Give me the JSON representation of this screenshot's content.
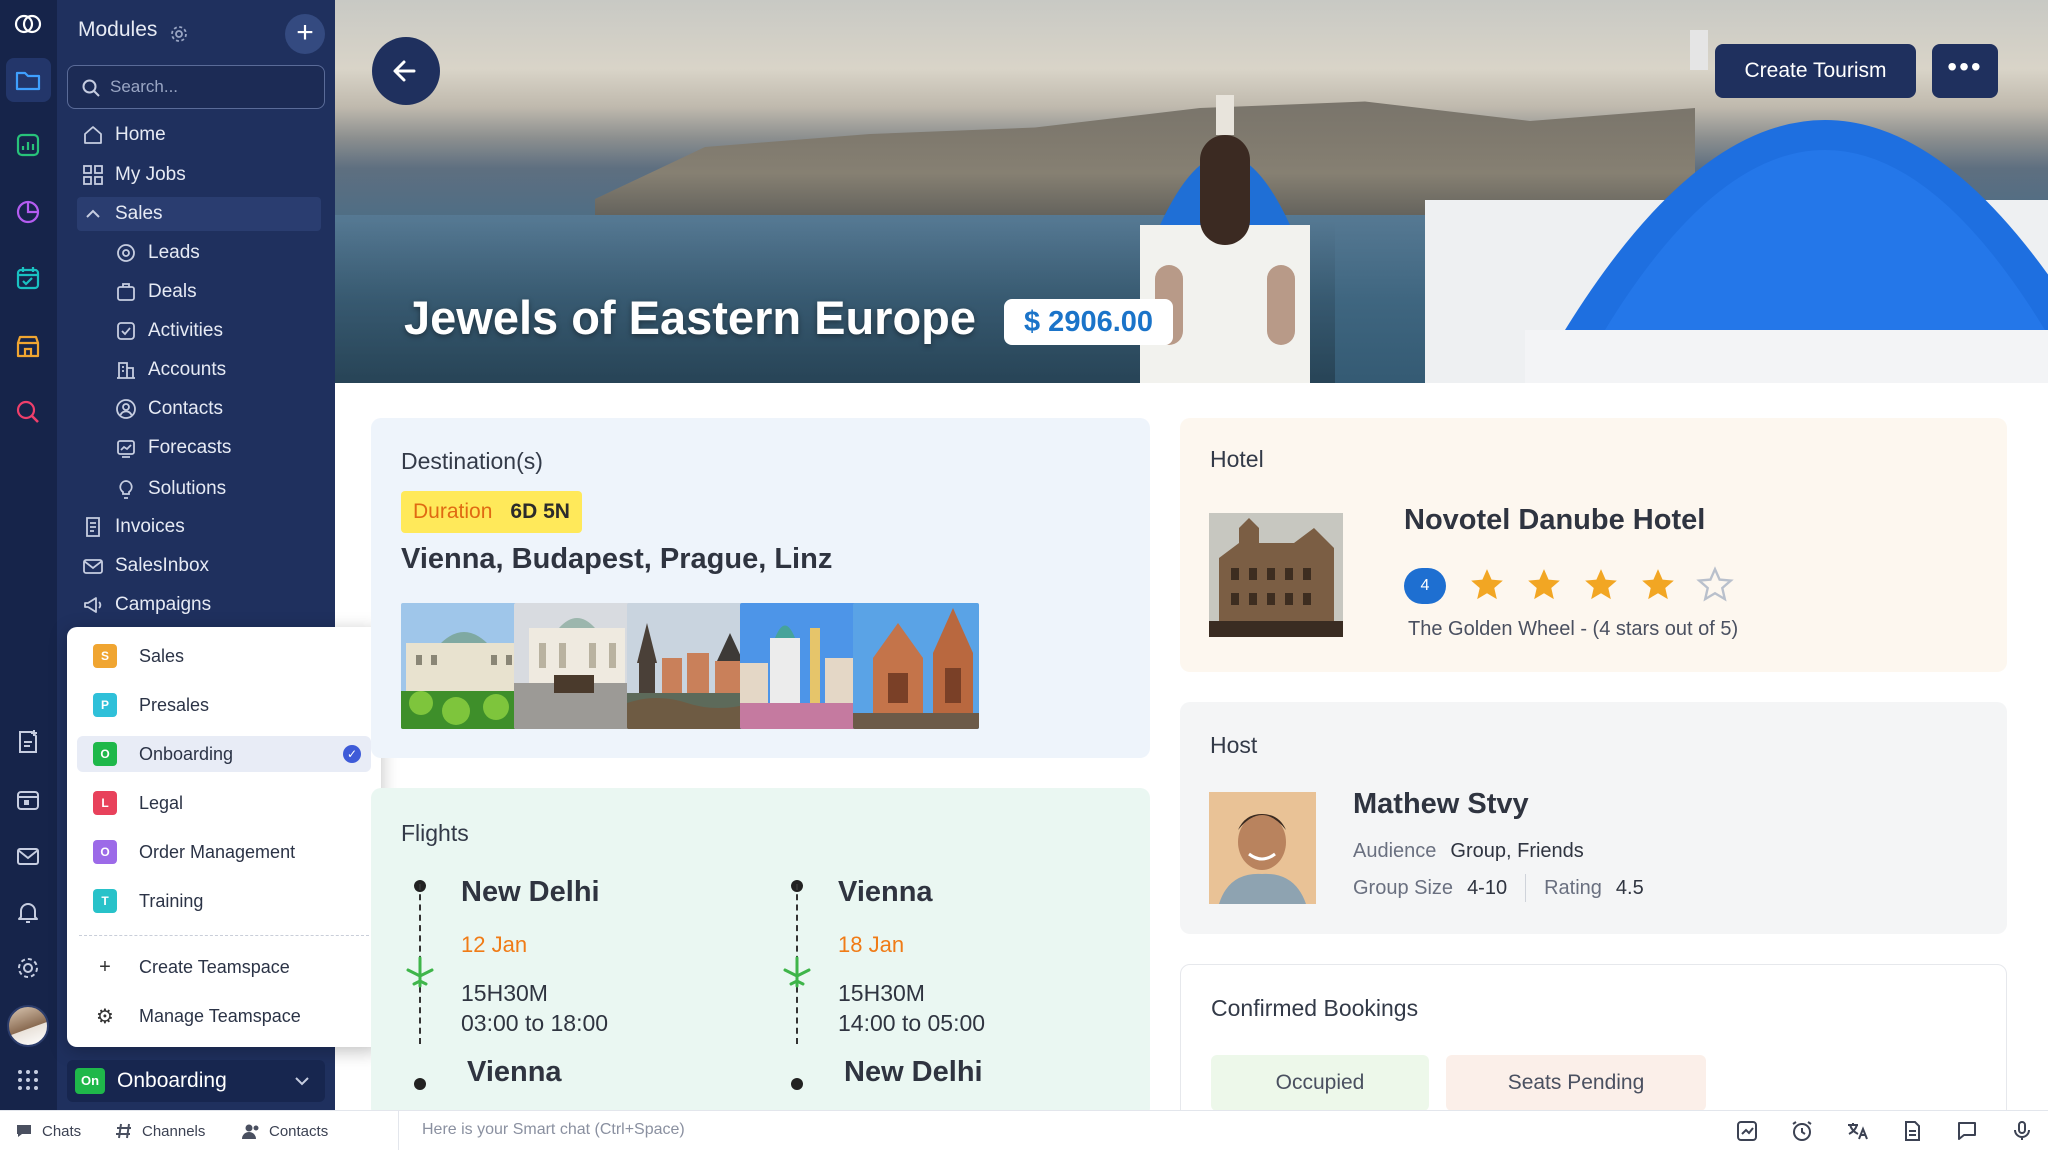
{
  "rail": {
    "icons": [
      "logo-icon",
      "folder-icon",
      "chart-icon",
      "pie-icon",
      "calendar-icon",
      "store-icon",
      "search-analytics-icon",
      "add-note-icon",
      "calendar-small-icon",
      "mail-icon",
      "bell-icon",
      "settings-icon",
      "avatar",
      "apps-grid-icon"
    ]
  },
  "sidebar": {
    "title": "Modules",
    "search_placeholder": "Search...",
    "items": [
      {
        "label": "Home",
        "icon": "home-icon"
      },
      {
        "label": "My Jobs",
        "icon": "grid-icon"
      },
      {
        "label": "Sales",
        "icon": "chevron-up-icon"
      },
      {
        "label": "Leads",
        "icon": "leads-icon"
      },
      {
        "label": "Deals",
        "icon": "deals-icon"
      },
      {
        "label": "Activities",
        "icon": "activities-icon"
      },
      {
        "label": "Accounts",
        "icon": "accounts-icon"
      },
      {
        "label": "Contacts",
        "icon": "contacts-icon"
      },
      {
        "label": "Forecasts",
        "icon": "forecasts-icon"
      },
      {
        "label": "Solutions",
        "icon": "bulb-icon"
      },
      {
        "label": "Invoices",
        "icon": "invoice-icon"
      },
      {
        "label": "SalesInbox",
        "icon": "inbox-icon"
      },
      {
        "label": "Campaigns",
        "icon": "megaphone-icon"
      }
    ]
  },
  "teamspace": {
    "options": [
      {
        "label": "Sales",
        "letter": "S",
        "color": "#f0a531"
      },
      {
        "label": "Presales",
        "letter": "P",
        "color": "#2fc0d9"
      },
      {
        "label": "Onboarding",
        "letter": "O",
        "color": "#1fb84a"
      },
      {
        "label": "Legal",
        "letter": "L",
        "color": "#e8415b"
      },
      {
        "label": "Order Management",
        "letter": "O",
        "color": "#9c6ae8"
      },
      {
        "label": "Training",
        "letter": "T",
        "color": "#28c2c9"
      }
    ],
    "selected": "Onboarding",
    "create_label": "Create Teamspace",
    "manage_label": "Manage Teamspace",
    "current_badge": "On",
    "current_label": "Onboarding"
  },
  "hero": {
    "title": "Jewels of Eastern Europe",
    "price": "$ 2906.00",
    "create_label": "Create Tourism",
    "more_label": "•••"
  },
  "destination": {
    "title": "Destination(s)",
    "duration_label": "Duration",
    "duration_value": "6D 5N",
    "cities": "Vienna, Budapest, Prague, Linz"
  },
  "flights": {
    "title": "Flights",
    "legs": [
      {
        "from": "New Delhi",
        "date": "12 Jan",
        "duration": "15H30M",
        "time": "03:00 to 18:00",
        "to": "Vienna"
      },
      {
        "from": "Vienna",
        "date": "18 Jan",
        "duration": "15H30M",
        "time": "14:00 to 05:00",
        "to": "New Delhi"
      }
    ]
  },
  "hotel": {
    "title": "Hotel",
    "name": "Novotel Danube Hotel",
    "rating": "4",
    "stars_filled": 4,
    "stars_total": 5,
    "subtitle": "The Golden Wheel - (4 stars out of 5)"
  },
  "host": {
    "title": "Host",
    "name": "Mathew Stvy",
    "audience_label": "Audience",
    "audience_value": "Group, Friends",
    "group_size_label": "Group Size",
    "group_size_value": "4-10",
    "rating_label": "Rating",
    "rating_value": "4.5"
  },
  "bookings": {
    "title": "Confirmed Bookings",
    "occupied_label": "Occupied",
    "pending_label": "Seats Pending"
  },
  "bottombar": {
    "chats": "Chats",
    "channels": "Channels",
    "contacts": "Contacts",
    "smart_chat": "Here is your Smart chat (Ctrl+Space)"
  },
  "colors": {
    "rail_bg": "#16244a",
    "sidebar_bg": "#1f305e",
    "accent_blue": "#1b74c9",
    "duration_yellow": "#ffe95a",
    "star": "#f2a623",
    "date_orange": "#f07b16",
    "plane_green": "#3fb54a"
  }
}
